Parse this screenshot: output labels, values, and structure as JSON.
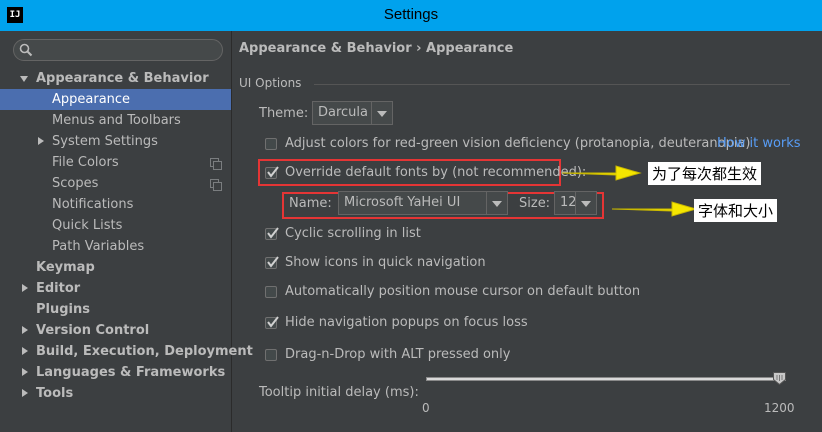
{
  "window": {
    "app_icon_text": "IJ",
    "title": "Settings"
  },
  "sidebar": {
    "search_placeholder": "",
    "items": [
      {
        "label": "Appearance & Behavior",
        "expanded": true,
        "bold": true
      },
      {
        "label": "Appearance",
        "selected": true
      },
      {
        "label": "Menus and Toolbars"
      },
      {
        "label": "System Settings",
        "collapsed": true
      },
      {
        "label": "File Colors",
        "icon": "copy-icon"
      },
      {
        "label": "Scopes",
        "icon": "copy-icon"
      },
      {
        "label": "Notifications"
      },
      {
        "label": "Quick Lists"
      },
      {
        "label": "Path Variables"
      },
      {
        "label": "Keymap",
        "bold": true
      },
      {
        "label": "Editor",
        "bold": true,
        "collapsed": true
      },
      {
        "label": "Plugins",
        "bold": true
      },
      {
        "label": "Version Control",
        "bold": true,
        "collapsed": true
      },
      {
        "label": "Build, Execution, Deployment",
        "bold": true,
        "collapsed": true
      },
      {
        "label": "Languages & Frameworks",
        "bold": true,
        "collapsed": true
      },
      {
        "label": "Tools",
        "bold": true,
        "collapsed": true
      }
    ]
  },
  "main": {
    "breadcrumb": "Appearance & Behavior › Appearance",
    "group_title": "UI Options",
    "theme_label": "Theme:",
    "theme_value": "Darcula",
    "options": [
      {
        "label": "Adjust colors for red-green vision deficiency (protanopia, deuteranopia)",
        "checked": false
      },
      {
        "label": "Override default fonts by (not recommended):",
        "checked": true
      },
      {
        "label": "Cyclic scrolling in list",
        "checked": true
      },
      {
        "label": "Show icons in quick navigation",
        "checked": true
      },
      {
        "label": "Automatically position mouse cursor on default button",
        "checked": false
      },
      {
        "label": "Hide navigation popups on focus loss",
        "checked": true
      },
      {
        "label": "Drag-n-Drop with ALT pressed only",
        "checked": false
      }
    ],
    "how_it_works_link": "How it works",
    "font_name_label": "Name:",
    "font_name_value": "Microsoft YaHei UI",
    "font_size_label": "Size:",
    "font_size_value": "12",
    "tooltip_label": "Tooltip initial delay (ms):",
    "tooltip_min": "0",
    "tooltip_max": "1200",
    "tooltip_value_fraction": 1.0
  },
  "annotations": {
    "note_override": "为了每次都生效",
    "note_font": "字体和大小"
  },
  "colors": {
    "title_bar": "#00a2ed",
    "selection": "#4b6eaf",
    "link": "#589df6",
    "highlight_box": "#e53535",
    "arrow": "#f5e600"
  }
}
